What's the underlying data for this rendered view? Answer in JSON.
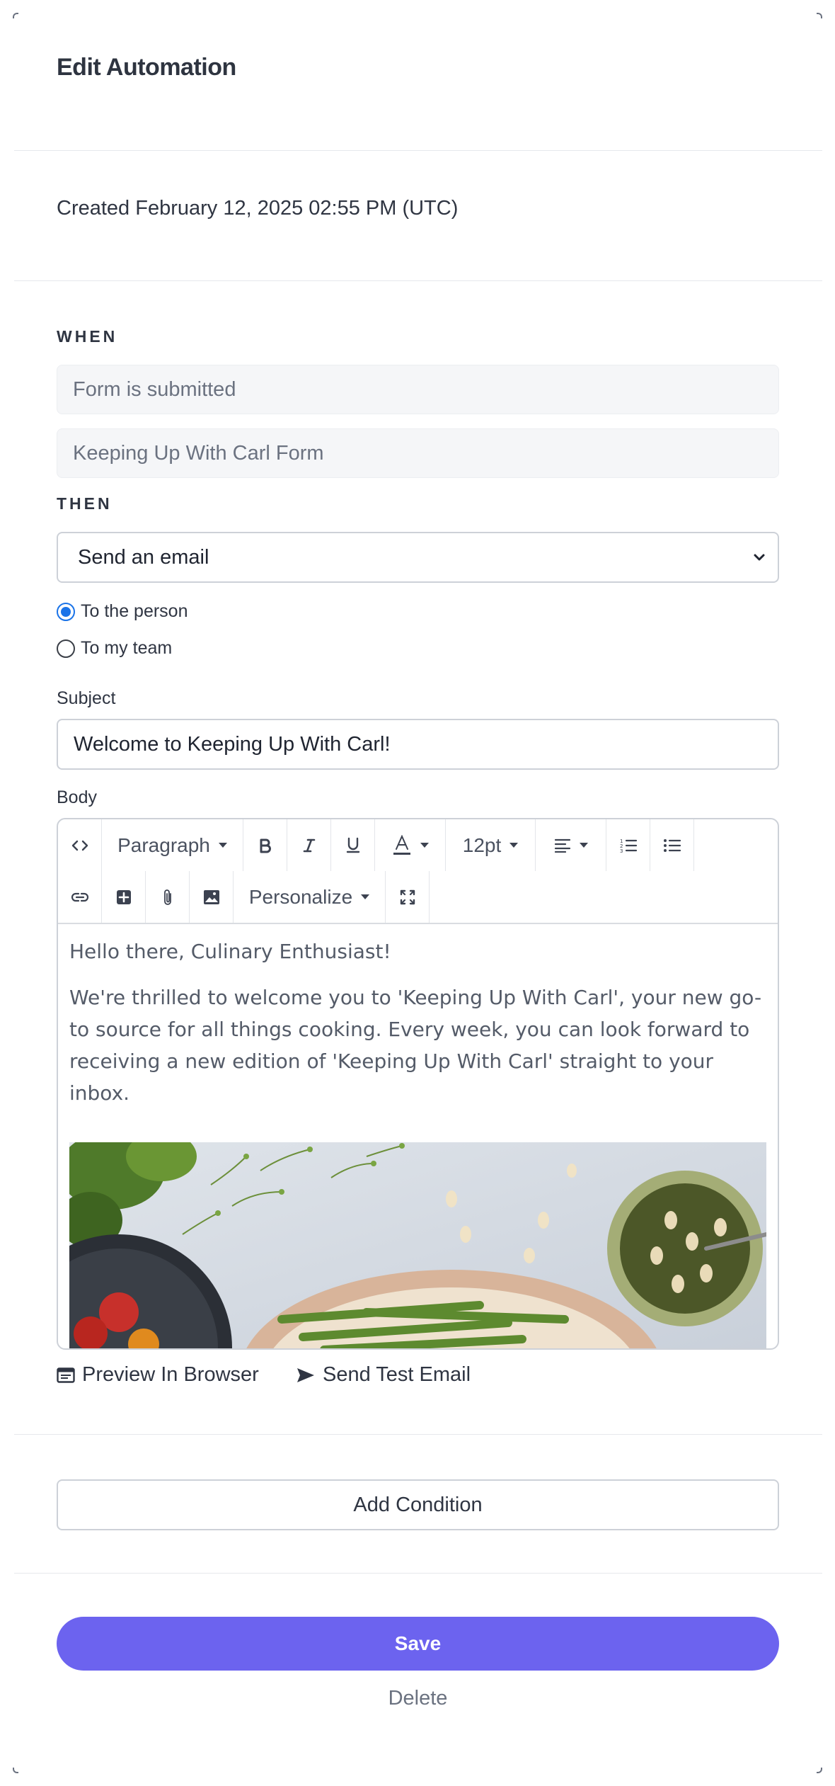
{
  "header": {
    "title": "Edit Automation"
  },
  "meta": {
    "created": "Created February 12, 2025 02:55 PM (UTC)"
  },
  "when": {
    "label": "WHEN",
    "trigger": "Form is submitted",
    "form": "Keeping Up With Carl Form"
  },
  "then": {
    "label": "THEN",
    "action": "Send an email",
    "recipients": [
      {
        "label": "To the person",
        "checked": true
      },
      {
        "label": "To my team",
        "checked": false
      }
    ]
  },
  "subject": {
    "label": "Subject",
    "value": "Welcome to Keeping Up With Carl!"
  },
  "body": {
    "label": "Body",
    "toolbar": {
      "block_format": "Paragraph",
      "font_size": "12pt",
      "personalize": "Personalize"
    },
    "greeting": "Hello there, Culinary Enthusiast!",
    "paragraph": "We're thrilled to welcome you to 'Keeping Up With Carl', your new go-to source for all things cooking. Every week, you can look forward to receiving a new edition of 'Keeping Up With Carl' straight to your inbox."
  },
  "actions": {
    "preview": "Preview In Browser",
    "send_test": "Send Test Email",
    "add_condition": "Add Condition",
    "save": "Save",
    "delete": "Delete"
  },
  "colors": {
    "primary": "#6c63ef",
    "radio_checked": "#1a73e8"
  }
}
